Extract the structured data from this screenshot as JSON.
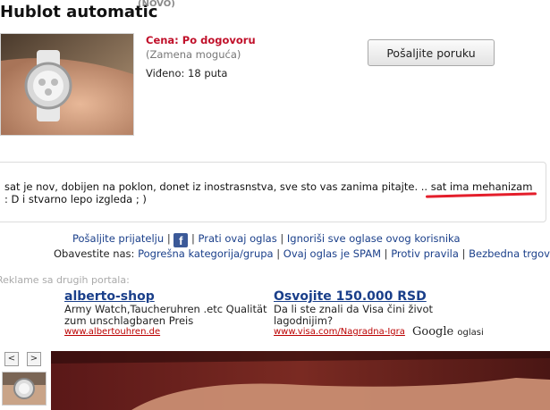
{
  "listing": {
    "title": "Hublot automatic",
    "badge": "(NOVO)",
    "price": "Cena: Po dogovoru",
    "exchange": "(Zamena moguća)",
    "views": "Viđeno: 18 puta",
    "send_button": "Pošaljite poruku"
  },
  "description": {
    "line1": "sat je nov, dobijen na poklon, donet iz inostrasnstva, sve sto vas zanima pitajte. .. sat ima mehanizam",
    "line2": ": D i stvarno lepo izgleda ; )"
  },
  "actions": {
    "send_friend": "Pošaljite prijatelju",
    "follow": "Prati ovaj oglas",
    "ignore": "Ignoriši sve oglase ovog korisnika",
    "notify_prefix": "Obavestite nas:",
    "wrong_category": "Pogrešna kategorija/grupa",
    "spam": "Ovaj oglas je SPAM",
    "against_rules": "Protiv pravila",
    "safe_trade": "Bezbedna trgovina"
  },
  "ads": {
    "header": "Reklame sa drugih portala:",
    "items": [
      {
        "title": "alberto-shop",
        "text": "Army Watch,Taucheruhren .etc Qualität zum unschlagbaren Preis",
        "url": "www.albertouhren.de"
      },
      {
        "title": "Osvojite 150.000 RSD",
        "text": "Da li ste znali da Visa čini život lagodnijim?",
        "url": "www.visa.com/Nagradna-Igra"
      }
    ],
    "google_label": "Google",
    "google_suffix": "oglasi"
  },
  "gallery": {
    "prev": "<",
    "next": ">"
  },
  "colors": {
    "price": "#c0102a",
    "link": "#1a3f8a",
    "annotation": "#e41e2b"
  }
}
